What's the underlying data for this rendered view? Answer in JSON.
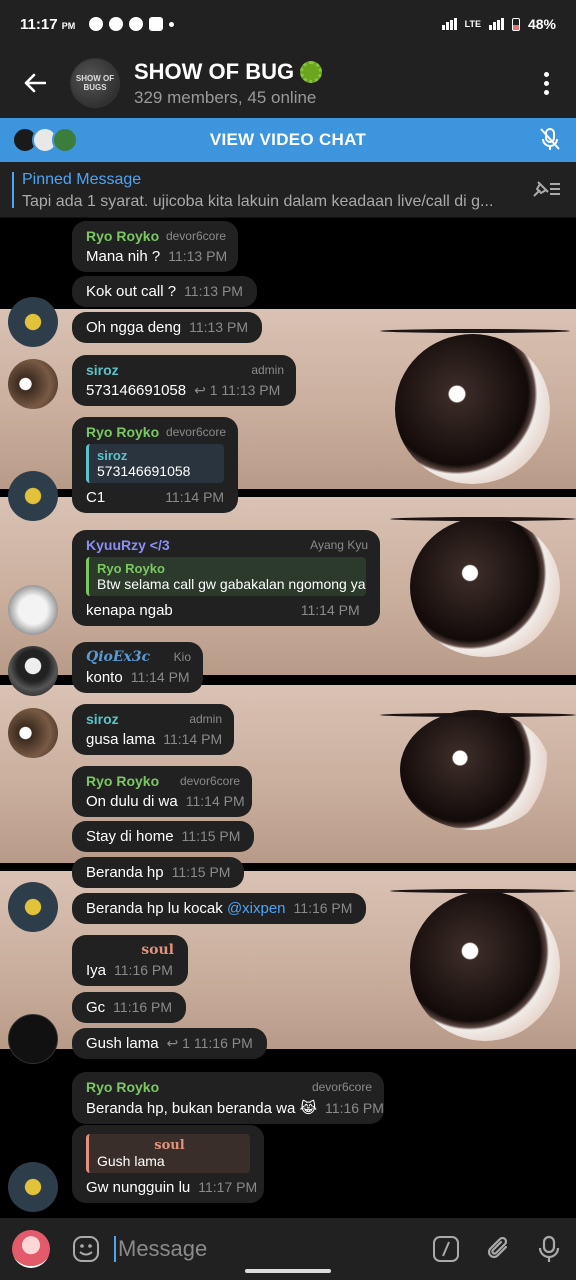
{
  "status": {
    "time": "11:17",
    "ampm": "PM",
    "battery": "48%",
    "network": "LTE"
  },
  "header": {
    "back_icon": "arrow-left-icon",
    "avatar_text": "SHOW OF BUGS",
    "title": "SHOW OF BUG",
    "subtitle": "329 members, 45 online"
  },
  "video_chat": {
    "label": "VIEW VIDEO CHAT"
  },
  "pinned": {
    "title": "Pinned Message",
    "text": "Tapi ada 1 syarat.    ujicoba kita lakuin dalam keadaan live/call di g..."
  },
  "messages": [
    {
      "name": "Ryo Royko",
      "tag": "devor6core",
      "text": "Mana nih ?",
      "time": "11:13 PM"
    },
    {
      "text": "Kok out call ?",
      "time": "11:13 PM"
    },
    {
      "text": "Oh ngga deng",
      "time": "11:13 PM"
    },
    {
      "name": "siroz",
      "tag": "admin",
      "text": "573146691058",
      "replies": "1",
      "time": "11:13 PM"
    },
    {
      "name": "Ryo Royko",
      "tag": "devor6core",
      "reply_name": "siroz",
      "reply_text": "573146691058",
      "text": "C1",
      "time": "11:14 PM"
    },
    {
      "name": "KyuuRzy </3",
      "tag": "Ayang Kyu",
      "reply_name": "Ryo Royko",
      "reply_text": "Btw selama call gw gabakalan ngomong ya",
      "text": "kenapa ngab",
      "time": "11:14 PM"
    },
    {
      "name": "QioEx3c",
      "tag": "Kio",
      "text": "konto",
      "time": "11:14 PM"
    },
    {
      "name": "siroz",
      "tag": "admin",
      "text": "gusa lama",
      "time": "11:14 PM"
    },
    {
      "name": "Ryo Royko",
      "tag": "devor6core",
      "text": "On dulu di wa",
      "time": "11:14 PM"
    },
    {
      "text": "Stay di home",
      "time": "11:15 PM"
    },
    {
      "text": "Beranda hp",
      "time": "11:15 PM"
    },
    {
      "text": "Beranda hp lu kocak",
      "mention": "@xixpen",
      "time": "11:16 PM"
    },
    {
      "name": "soul",
      "text": "Iya",
      "time": "11:16 PM"
    },
    {
      "text": "Gc",
      "time": "11:16 PM"
    },
    {
      "text": "Gush lama",
      "replies": "1",
      "time": "11:16 PM"
    },
    {
      "name": "Ryo Royko",
      "tag": "devor6core",
      "text": "Beranda hp, bukan beranda wa 😹",
      "time": "11:16 PM"
    },
    {
      "reply_name": "soul",
      "reply_text": "Gush lama",
      "text": "Gw nungguin lu",
      "time": "11:17 PM"
    }
  ],
  "input": {
    "placeholder": "Message"
  },
  "colors": {
    "accent": "#4ea4f6",
    "header_bg": "#212121",
    "bubble_bg": "#212121",
    "green_name": "#7bc862",
    "teal_name": "#5cc3c8",
    "purple_name": "#8d8ef5",
    "soul_name": "#e0927c"
  }
}
